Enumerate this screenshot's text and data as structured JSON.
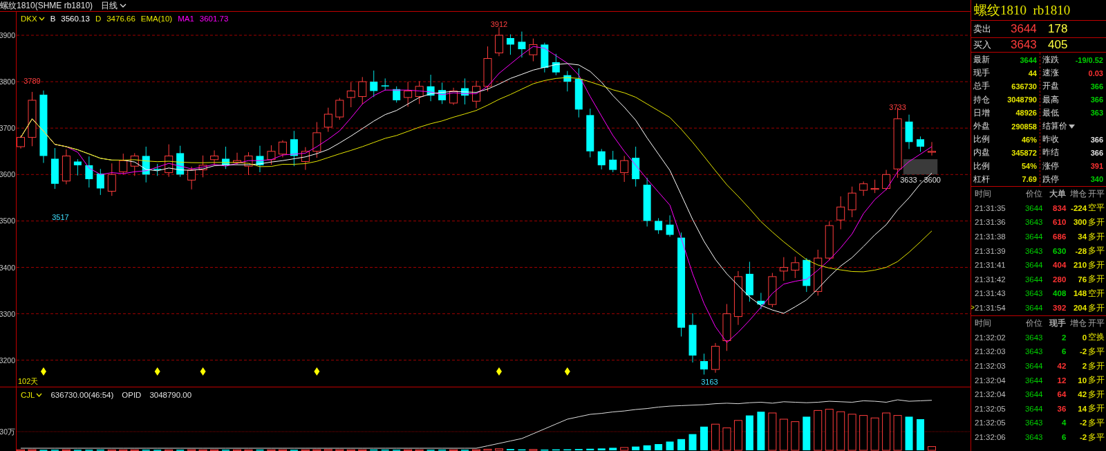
{
  "header": {
    "title": "螺纹1810(SHME rb1810)",
    "period": "日线"
  },
  "price_chart": {
    "legend": [
      {
        "name": "DKX",
        "dropdown": true,
        "color": "#e6e600"
      },
      {
        "name": "B",
        "value": "3560.13",
        "color": "#ffffff"
      },
      {
        "name": "D",
        "value": "3476.66",
        "color": "#e6e600"
      },
      {
        "name": "EMA(10)",
        "color": "#e6e600"
      },
      {
        "name": "MA1",
        "value": "3601.73",
        "color": "#ff00ff"
      }
    ],
    "axis_labels": [
      "3900",
      "3800",
      "3700",
      "3600",
      "3500",
      "3400",
      "3300",
      "3200"
    ],
    "price_labels": [
      "3789",
      "3517",
      "3912",
      "3163",
      "3733"
    ],
    "range_label": "3633 - 3600",
    "span_label": "102天"
  },
  "volume_chart": {
    "legend": [
      {
        "name": "CJL",
        "dropdown": true,
        "value": "636730.00(46:54)",
        "color": "#e6e600"
      },
      {
        "name": "OPID",
        "value": "3048790.00",
        "color": "#e0e0e0"
      }
    ],
    "axis_labels": [
      "30万"
    ]
  },
  "quote": {
    "title": "螺纹1810  rb1810",
    "ask": {
      "label": "卖出",
      "price": "3644",
      "volume": "178"
    },
    "bid": {
      "label": "买入",
      "price": "3643",
      "volume": "405"
    }
  },
  "stats_left": [
    {
      "label": "最新",
      "value": "3644",
      "color": "#00d000"
    },
    {
      "label": "现手",
      "value": "44",
      "color": "#e6e600"
    },
    {
      "label": "总手",
      "value": "636730",
      "color": "#e6e600"
    },
    {
      "label": "持仓",
      "value": "3048790",
      "color": "#e6e600"
    },
    {
      "label": "日增",
      "value": "48926",
      "color": "#e6e600"
    },
    {
      "label": "外盘",
      "value": "290858",
      "color": "#e6e600"
    },
    {
      "label": "比例",
      "value": "46%",
      "color": "#e6e600"
    },
    {
      "label": "内盘",
      "value": "345872",
      "color": "#e6e600"
    },
    {
      "label": "比例",
      "value": "54%",
      "color": "#e6e600"
    },
    {
      "label": "杠杆",
      "value": "7.69",
      "color": "#e6e600"
    }
  ],
  "stats_right": [
    {
      "label": "涨跌",
      "value": "-19/0.52",
      "color": "#00d000"
    },
    {
      "label": "速涨",
      "value": "0.03",
      "color": "#ff3232"
    },
    {
      "label": "开盘",
      "value": "366",
      "color": "#00d000"
    },
    {
      "label": "最高",
      "value": "366",
      "color": "#00d000"
    },
    {
      "label": "最低",
      "value": "363",
      "color": "#00d000"
    },
    {
      "label": "结算价",
      "dropdown": true
    },
    {
      "label": "昨收",
      "value": "366",
      "color": "#e0e0e0"
    },
    {
      "label": "昨结",
      "value": "366",
      "color": "#e0e0e0"
    },
    {
      "label": "涨停",
      "value": "391",
      "color": "#ff3232"
    },
    {
      "label": "跌停",
      "value": "340",
      "color": "#00d000"
    }
  ],
  "big_trades": {
    "columns": [
      "时间",
      "价位",
      "大单",
      "增仓",
      "开平"
    ],
    "rows": [
      {
        "time": "21:31:35",
        "price": "3644",
        "volume": "834",
        "color": "#ff3232",
        "change": "-224",
        "action": "空平"
      },
      {
        "time": "21:31:36",
        "price": "3643",
        "volume": "610",
        "color": "#ff3232",
        "change": "300",
        "action": "多开"
      },
      {
        "time": "21:31:38",
        "price": "3644",
        "volume": "686",
        "color": "#ff3232",
        "change": "34",
        "action": "多开"
      },
      {
        "time": "21:31:39",
        "price": "3643",
        "volume": "630",
        "color": "#00d000",
        "change": "-28",
        "action": "多平"
      },
      {
        "time": "21:31:41",
        "price": "3644",
        "volume": "404",
        "color": "#ff3232",
        "change": "210",
        "action": "多开"
      },
      {
        "time": "21:31:42",
        "price": "3644",
        "volume": "280",
        "color": "#ff3232",
        "change": "76",
        "action": "多开"
      },
      {
        "time": "21:31:43",
        "price": "3643",
        "volume": "408",
        "color": "#00d000",
        "change": "148",
        "action": "空开"
      },
      {
        "time": "21:31:54",
        "price": "3644",
        "volume": "392",
        "color": "#ff3232",
        "change": "204",
        "action": "多开",
        "marker": ">"
      }
    ]
  },
  "ticks": {
    "columns": [
      "时间",
      "价位",
      "现手",
      "增仓",
      "开平"
    ],
    "rows": [
      {
        "time": "21:32:02",
        "price": "3643",
        "volume": "2",
        "color": "#00d000",
        "change": "0",
        "action": "空换"
      },
      {
        "time": "21:32:03",
        "price": "3643",
        "volume": "6",
        "color": "#00d000",
        "change": "-2",
        "action": "多平"
      },
      {
        "time": "21:32:03",
        "price": "3644",
        "volume": "42",
        "color": "#ff3232",
        "change": "2",
        "action": "多开"
      },
      {
        "time": "21:32:04",
        "price": "3644",
        "volume": "12",
        "color": "#ff3232",
        "change": "10",
        "action": "多开"
      },
      {
        "time": "21:32:04",
        "price": "3644",
        "volume": "64",
        "color": "#ff3232",
        "change": "42",
        "action": "多开"
      },
      {
        "time": "21:32:05",
        "price": "3644",
        "volume": "36",
        "color": "#ff3232",
        "change": "14",
        "action": "多开"
      },
      {
        "time": "21:32:05",
        "price": "3643",
        "volume": "4",
        "color": "#00d000",
        "change": "-2",
        "action": "多平"
      },
      {
        "time": "21:32:06",
        "price": "3643",
        "volume": "6",
        "color": "#00d000",
        "change": "-2",
        "action": "多平"
      }
    ]
  }
}
